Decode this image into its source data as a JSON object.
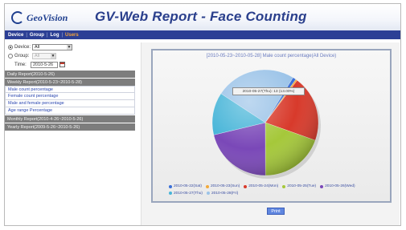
{
  "header": {
    "logo_text": "GeoVision",
    "title": "GV-Web Report - Face Counting"
  },
  "nav": {
    "items": [
      {
        "label": "Device",
        "active": false
      },
      {
        "label": "Group",
        "active": false
      },
      {
        "label": "Log",
        "active": false
      },
      {
        "label": "Users",
        "active": true
      }
    ]
  },
  "filters": {
    "device_label": "Device:",
    "device_value": "All",
    "group_label": "Group:",
    "group_value": "All",
    "time_label": "Time:",
    "time_value": "2010-5-26"
  },
  "sidebar": {
    "daily_report": "Daily Report(2010-5-26)",
    "weekly_report": "Weekly Report(2010-5-23~2010-5-28)",
    "links": [
      "Male count percentage",
      "Female count percentage",
      "Male and female percentage",
      "Age range Percentage"
    ],
    "monthly_report": "Monthly Report(2010-4-26~2010-5-26)",
    "yearly_report": "Yearly Report(2009-5-26~2010-5-26)"
  },
  "chart_data": {
    "type": "pie",
    "title": "[2010-05-23~2010-05-28] Male count percentage(All Device)",
    "legend_placement": "bottom",
    "categories": [
      "2010-05-22(Sat)",
      "2010-05-23(Sun)",
      "2010-05-24(Mon)",
      "2010-05-25(Tue)",
      "2010-05-26(Wed)",
      "2010-05-27(Thu)",
      "2010-05-28(Fri)"
    ],
    "values": [
      1.0,
      0.5,
      20.2,
      19.5,
      21.3,
      13.0,
      24.5
    ],
    "colors": [
      "#3a6fd8",
      "#f2a93b",
      "#d83a2b",
      "#a5c83a",
      "#7a48b8",
      "#48b5d8",
      "#9bc3e8"
    ]
  },
  "tooltip": {
    "text": "2010-05-27(Thu): 13 (13.00%)"
  },
  "actions": {
    "print_label": "Print"
  }
}
